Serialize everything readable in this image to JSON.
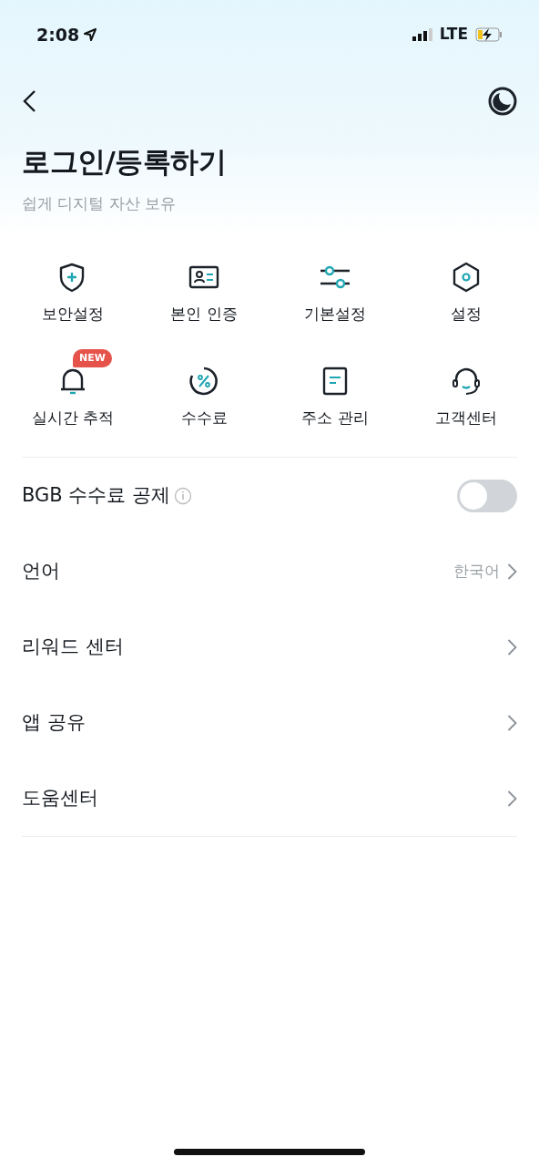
{
  "status_bar": {
    "time": "2:08",
    "network": "LTE"
  },
  "header": {
    "title": "로그인/등록하기",
    "subtitle": "쉽게 디지털 자산 보유"
  },
  "shortcuts": [
    {
      "label": "보안설정",
      "kind": "shield"
    },
    {
      "label": "본인 인증",
      "kind": "idcard"
    },
    {
      "label": "기본설정",
      "kind": "sliders"
    },
    {
      "label": "설정",
      "kind": "hexagon"
    },
    {
      "label": "실시간 추적",
      "kind": "bell",
      "badge": "NEW"
    },
    {
      "label": "수수료",
      "kind": "percent"
    },
    {
      "label": "주소 관리",
      "kind": "document"
    },
    {
      "label": "고객센터",
      "kind": "headset"
    }
  ],
  "menu": [
    {
      "label": "BGB 수수료 공제",
      "kind": "toggle",
      "info": true,
      "on": false
    },
    {
      "label": "언어",
      "kind": "link",
      "value": "한국어"
    },
    {
      "label": "리워드 센터",
      "kind": "link"
    },
    {
      "label": "앱 공유",
      "kind": "link"
    },
    {
      "label": "도움센터",
      "kind": "link"
    }
  ]
}
